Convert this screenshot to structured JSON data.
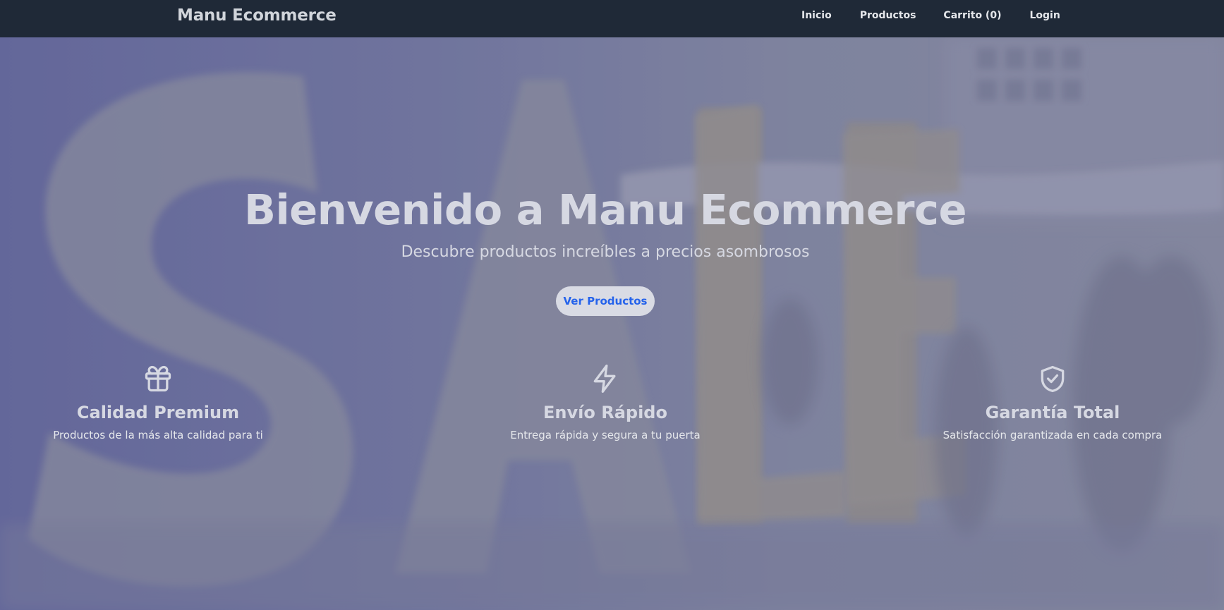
{
  "navbar": {
    "brand": "Manu Ecommerce",
    "links": [
      {
        "label": "Inicio"
      },
      {
        "label": "Productos"
      },
      {
        "label": "Carrito (0)"
      },
      {
        "label": "Login"
      }
    ]
  },
  "hero": {
    "title": "Bienvenido a Manu Ecommerce",
    "subtitle": "Descubre productos increíbles a precios asombrosos",
    "cta_label": "Ver Productos",
    "background_text": "SALE"
  },
  "features": [
    {
      "icon": "gift-icon",
      "title": "Calidad Premium",
      "description": "Productos de la más alta calidad para ti"
    },
    {
      "icon": "lightning-icon",
      "title": "Envío Rápido",
      "description": "Entrega rápida y segura a tu puerta"
    },
    {
      "icon": "shield-check-icon",
      "title": "Garantía Total",
      "description": "Satisfacción garantizada en cada compra"
    }
  ],
  "colors": {
    "navbar_bg": "#1f2937",
    "cta_text": "#2563eb",
    "text_light": "#d6d8e2"
  }
}
